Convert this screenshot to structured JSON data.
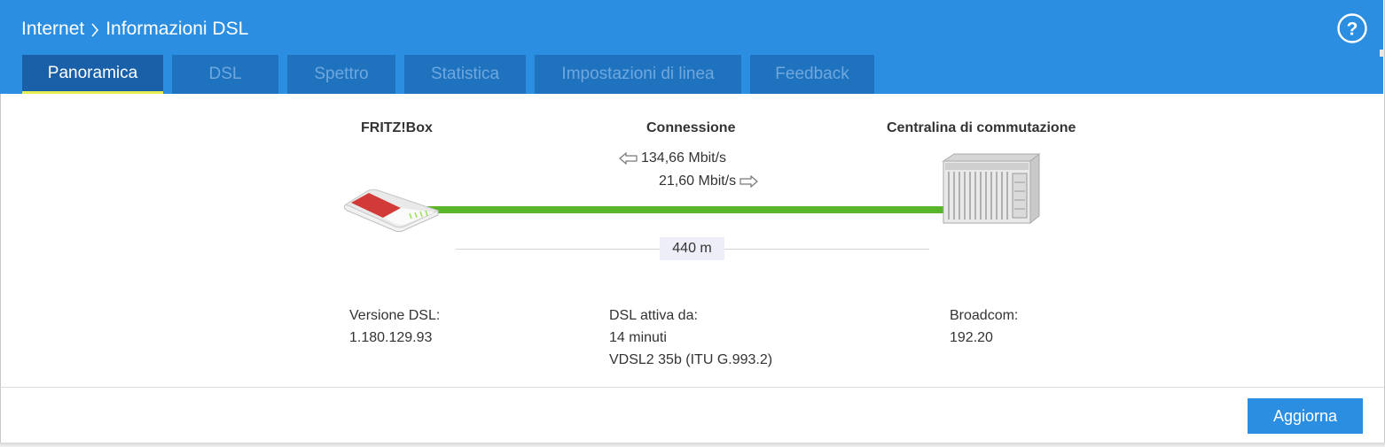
{
  "header": {
    "breadcrumb_parent": "Internet",
    "breadcrumb_current": "Informazioni DSL",
    "help_icon": "question-circle-icon"
  },
  "tabs": [
    {
      "label": "Panoramica",
      "active": true
    },
    {
      "label": "DSL",
      "active": false
    },
    {
      "label": "Spettro",
      "active": false
    },
    {
      "label": "Statistica",
      "active": false
    },
    {
      "label": "Impostazioni di linea",
      "active": false
    },
    {
      "label": "Feedback",
      "active": false
    }
  ],
  "overview": {
    "device_title": "FRITZ!Box",
    "connection_title": "Connessione",
    "exchange_title": "Centralina di commutazione",
    "downstream": "134,66 Mbit/s",
    "upstream": "21,60 Mbit/s",
    "distance": "440 m"
  },
  "info": {
    "dsl_version_label": "Versione DSL:",
    "dsl_version_value": "1.180.129.93",
    "dsl_active_label": "DSL attiva da:",
    "dsl_active_value": "14 minuti",
    "dsl_standard": "VDSL2 35b (ITU G.993.2)",
    "chipset_label": "Broadcom:",
    "chipset_value": "192.20"
  },
  "footer": {
    "refresh_label": "Aggiorna"
  },
  "colors": {
    "header_bg": "#2b8ee0",
    "tab_bg": "#1f72be",
    "tab_active_underline": "#e6ef52",
    "line_green": "#59b52a"
  }
}
